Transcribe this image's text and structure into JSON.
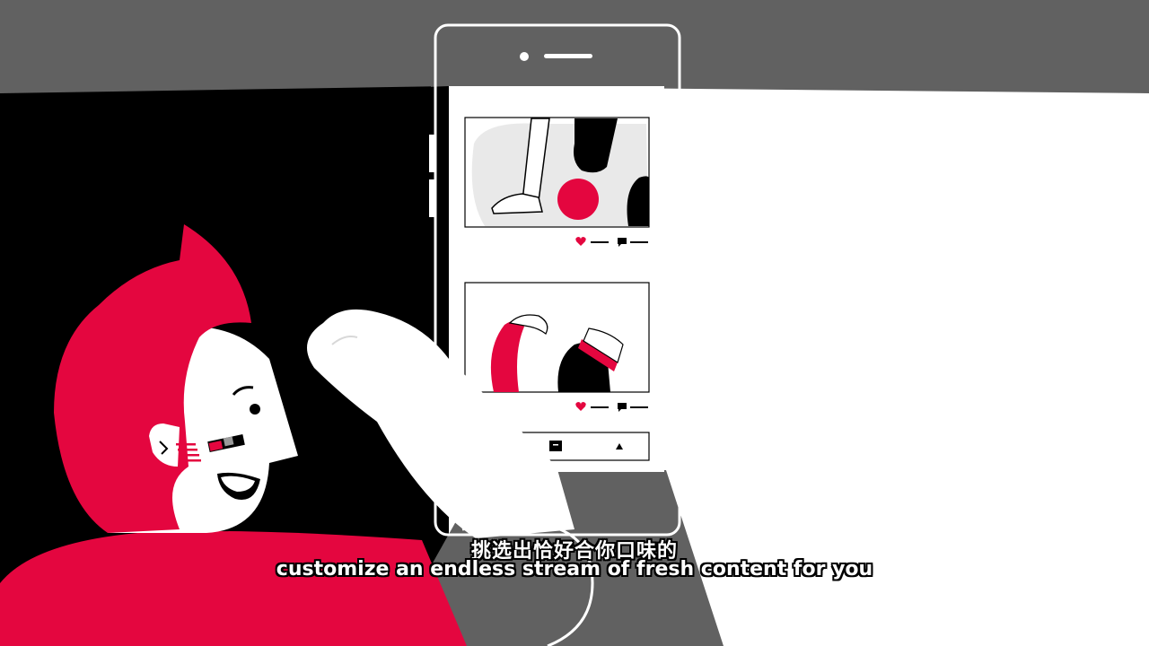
{
  "subtitles": {
    "chinese": "挑选出恰好合你口味的",
    "english": "customize an endless stream of fresh content for you"
  },
  "colors": {
    "accent_red": "#e4063f",
    "background_gray": "#616161",
    "ink": "#000000",
    "paper": "#ffffff"
  },
  "icons": {
    "like": "heart-icon",
    "comment": "comment-icon",
    "add": "add-post-icon",
    "profile": "profile-triangle-icon"
  }
}
